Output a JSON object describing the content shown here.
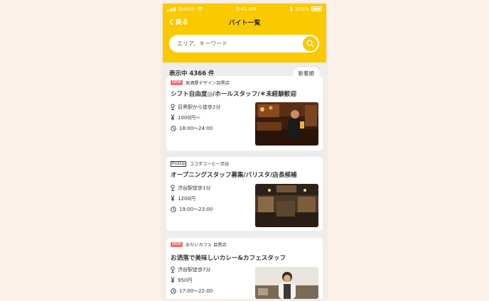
{
  "status": {
    "carrier": "Sketch",
    "time": "9:41 AM",
    "battery": "100%"
  },
  "nav": {
    "back_label": "戻る",
    "title": "バイト一覧"
  },
  "search": {
    "placeholder": "エリア、キーワード"
  },
  "list": {
    "count_label": "表示中 4366 件",
    "sort_label": "新着順"
  },
  "jobs": [
    {
      "badge": "NEW",
      "shop": "居酒屋デザイン目黒店",
      "title": "シフト自由度◎/ホールスタッフ/＊未経験歓迎",
      "access": "目黒駅から徒歩2分",
      "wage": "1000円〜",
      "hours": "18:00〜24:00"
    },
    {
      "badge": "PickUp",
      "shop": "ココダコーヒー渋谷",
      "title": "オープニングスタッフ募集/バリスタ/店長候補",
      "access": "渋谷駅徒歩1分",
      "wage": "1200円",
      "hours": "19:00〜23:00"
    },
    {
      "badge": "NEW",
      "shop": "おだいカフェ 目黒店",
      "title": "お洒落で美味しいカレー&カフェスタッフ",
      "access": "渋谷駅徒歩7分",
      "wage": "950円",
      "hours": "17:00〜22:00"
    }
  ],
  "colors": {
    "accent": "#fbc900",
    "badge_new": "#f06b6b",
    "background": "#ededed"
  }
}
